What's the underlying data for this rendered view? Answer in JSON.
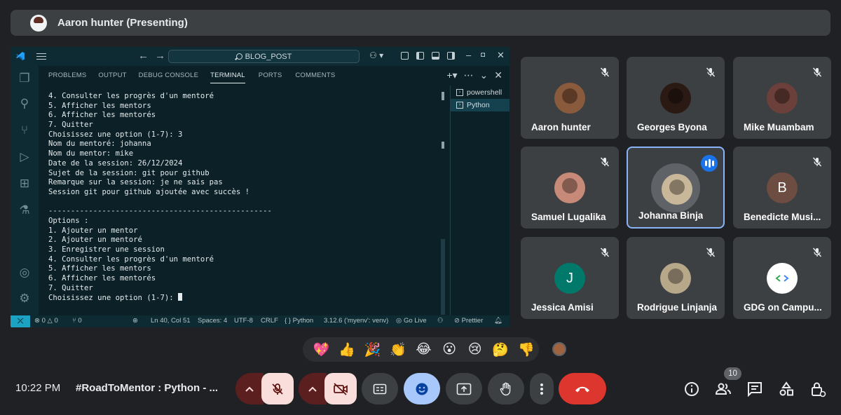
{
  "presenter": {
    "name": "Aaron hunter (Presenting)"
  },
  "vscode": {
    "search": "BLOG_POST",
    "panel_tabs": [
      "PROBLEMS",
      "OUTPUT",
      "DEBUG CONSOLE",
      "TERMINAL",
      "PORTS",
      "COMMENTS"
    ],
    "active_tab": "TERMINAL",
    "terminals": [
      "powershell",
      "Python"
    ],
    "active_terminal": "Python",
    "terminal_lines": [
      "4. Consulter les progrès d'un mentoré",
      "5. Afficher les mentors",
      "6. Afficher les mentorés",
      "7. Quitter",
      "Choisissez une option (1-7): 3",
      "Nom du mentoré: johanna",
      "Nom du mentor: mike",
      "Date de la session: 26/12/2024",
      "Sujet de la session: git pour github",
      "Remarque sur la session: je ne sais pas",
      "Session git pour github ajoutée avec succès !",
      "",
      "--------------------------------------------------",
      "Options :",
      "1. Ajouter un mentor",
      "2. Ajouter un mentoré",
      "3. Enregistrer une session",
      "4. Consulter les progrès d'un mentoré",
      "5. Afficher les mentors",
      "6. Afficher les mentorés",
      "7. Quitter",
      "Choisissez une option (1-7): "
    ],
    "status": {
      "problems": "0 △ 0",
      "ports": "0",
      "position": "Ln 40, Col 51",
      "spaces": "Spaces: 4",
      "encoding": "UTF-8",
      "eol": "CRLF",
      "language": "{ } Python",
      "interpreter": "3.12.6 ('myenv': venv)",
      "golive": "Go Live",
      "prettier": "Prettier"
    }
  },
  "participants": [
    {
      "name": "Aaron hunter",
      "avatar": "photo",
      "color": "#8a5a3c"
    },
    {
      "name": "Georges Byona",
      "avatar": "photo",
      "color": "#2b1a14"
    },
    {
      "name": "Mike Muambam",
      "avatar": "photo",
      "color": "#6b3f3a"
    },
    {
      "name": "Samuel Lugalika",
      "avatar": "photo",
      "color": "#c88a78"
    },
    {
      "name": "Johanna Binja",
      "avatar": "photo",
      "color": "#c9b79a",
      "speaking": true
    },
    {
      "name": "Benedicte Musi...",
      "avatar": "letter",
      "letter": "B",
      "color": "#6d4c41"
    },
    {
      "name": "Jessica Amisi",
      "avatar": "letter",
      "letter": "J",
      "color": "#00796b"
    },
    {
      "name": "Rodrigue Linjanja",
      "avatar": "photo",
      "color": "#b8a88a"
    },
    {
      "name": "GDG on Campu...",
      "avatar": "logo",
      "color": "#ffffff"
    }
  ],
  "reactions": [
    "💖",
    "👍",
    "🎉",
    "👏",
    "😂",
    "😮",
    "😢",
    "🤔",
    "👎"
  ],
  "bottom": {
    "time": "10:22 PM",
    "meeting": "#RoadToMentor : Python - ...",
    "participant_count": "10"
  },
  "colors": {
    "leave": "#dc362e",
    "speaking": "#8ab4f8",
    "muted_bg": "#f9dedc"
  }
}
